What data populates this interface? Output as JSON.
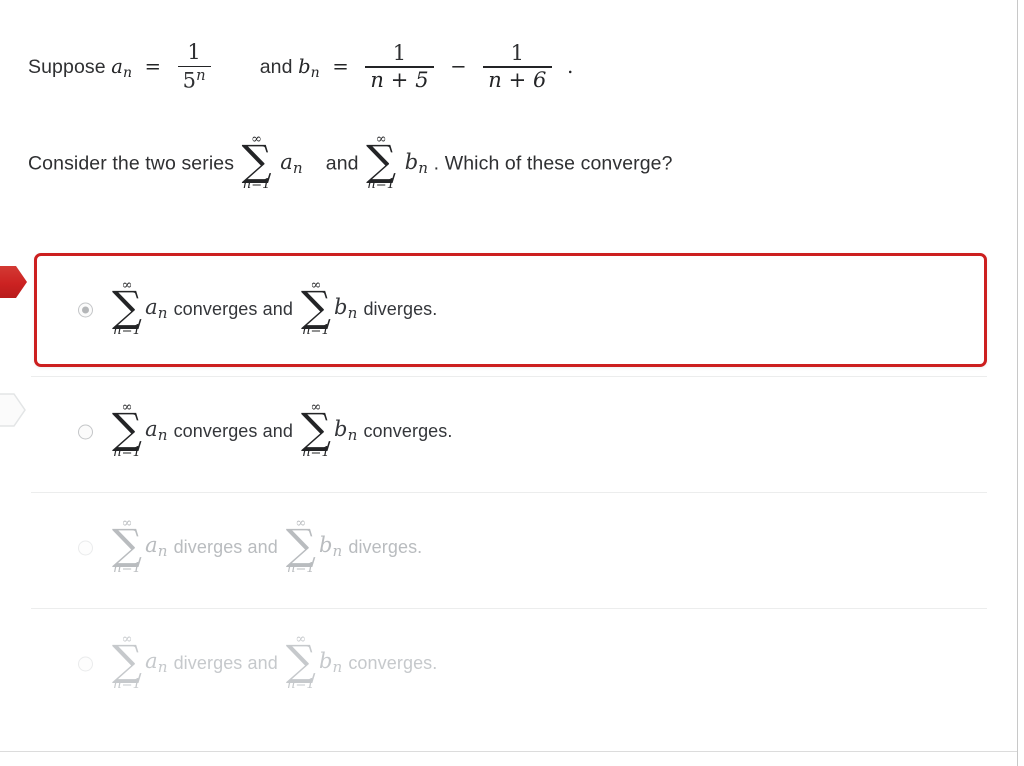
{
  "question": {
    "stem_line_1": {
      "lead": "Suppose",
      "a_symbol": "a",
      "a_sub": "n",
      "equals": "=",
      "a_value_num": "1",
      "a_value_den_base": "5",
      "a_value_den_exp": "n",
      "conjunction": "and",
      "b_symbol": "b",
      "b_sub": "n",
      "equals_2": "=",
      "b_term1_num": "1",
      "b_term1_den": "n + 5",
      "minus": "−",
      "b_term2_num": "1",
      "b_term2_den": "n + 6",
      "period": "."
    },
    "stem_line_2": {
      "lead": "Consider the two series",
      "sum1_top": "∞",
      "sum1_sigma": "∑",
      "sum1_bottom": "n=1",
      "sum1_arg": "a",
      "sum1_arg_sub": "n",
      "conjunction": "and",
      "sum2_top": "∞",
      "sum2_sigma": "∑",
      "sum2_bottom": "n=1",
      "sum2_arg": "b",
      "sum2_arg_sub": "n",
      "trailing": ". Which of these converge?"
    }
  },
  "sum_notation": {
    "top_limit": "∞",
    "sigma": "∑",
    "bottom_limit": "n=1"
  },
  "answers": [
    {
      "id": "option-a",
      "selected": true,
      "dimmed": false,
      "first_sum_arg": "a",
      "first_sum_arg_sub": "n",
      "middle_words": "converges and",
      "second_sum_arg": "b",
      "second_sum_arg_sub": "n",
      "trailing_words": "diverges."
    },
    {
      "id": "option-b",
      "selected": false,
      "dimmed": false,
      "first_sum_arg": "a",
      "first_sum_arg_sub": "n",
      "middle_words": "converges and",
      "second_sum_arg": "b",
      "second_sum_arg_sub": "n",
      "trailing_words": "converges."
    },
    {
      "id": "option-c",
      "selected": false,
      "dimmed": true,
      "first_sum_arg": "a",
      "first_sum_arg_sub": "n",
      "middle_words": "diverges and",
      "second_sum_arg": "b",
      "second_sum_arg_sub": "n",
      "trailing_words": "diverges."
    },
    {
      "id": "option-d",
      "selected": false,
      "dimmed": true,
      "first_sum_arg": "a",
      "first_sum_arg_sub": "n",
      "middle_words": "diverges and",
      "second_sum_arg": "b",
      "second_sum_arg_sub": "n",
      "trailing_words": "converges."
    }
  ],
  "markers": {
    "selected_marker_name": "red-pointer-marker",
    "next_marker_name": "gray-pointer-marker"
  },
  "colors": {
    "highlight_border": "#cc1f1f",
    "marker_red": "#cc2222",
    "marker_gray": "#e8eaea",
    "text": "#34363a",
    "dim_text": "#b9bcbf",
    "divider": "#eceded"
  }
}
